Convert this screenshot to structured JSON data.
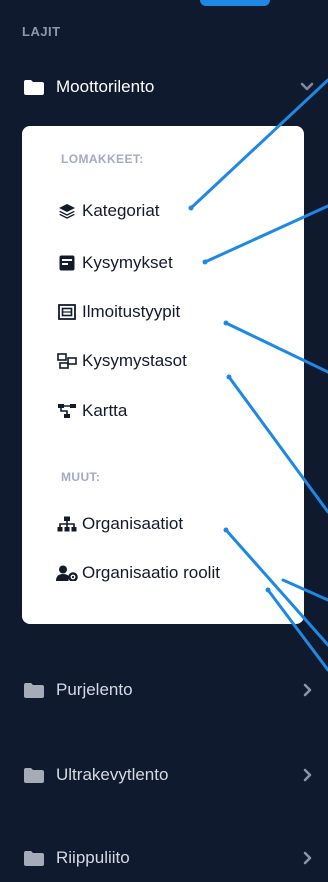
{
  "section_header": "LAJIT",
  "categories": [
    {
      "label": "Moottorilento",
      "expanded": true
    },
    {
      "label": "Purjelento",
      "expanded": false
    },
    {
      "label": "Ultrakevytlento",
      "expanded": false
    },
    {
      "label": "Riippuliito",
      "expanded": false
    }
  ],
  "submenu": {
    "forms_header": "LOMAKKEET:",
    "forms": [
      {
        "label": "Kategoriat",
        "icon": "layers-icon"
      },
      {
        "label": "Kysymykset",
        "icon": "question-list-icon"
      },
      {
        "label": "Ilmoitustyypit",
        "icon": "frame-icon"
      },
      {
        "label": "Kysymystasot",
        "icon": "project-diagram-icon"
      },
      {
        "label": "Kartta",
        "icon": "sitemap-map-icon"
      }
    ],
    "other_header": "MUUT:",
    "other": [
      {
        "label": "Organisaatiot",
        "icon": "org-chart-icon"
      },
      {
        "label": "Organisaatio roolit",
        "icon": "user-cog-icon"
      }
    ]
  },
  "colors": {
    "sidebar_bg": "#0f1a2e",
    "panel_bg": "#ffffff",
    "callout_line": "#1e88e5",
    "muted_label": "#8e97ab"
  }
}
